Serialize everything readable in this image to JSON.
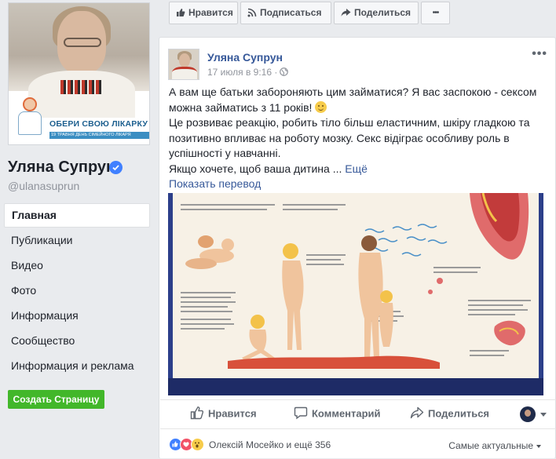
{
  "page": {
    "name": "Уляна Супрун",
    "handle": "@ulanasuprun",
    "cover": {
      "banner_title": "ОБЕРИ СВОЮ ЛІКАРКУ",
      "banner_subtitle": "19 ТРАВНЯ ДЕНЬ СІМЕЙНОГО ЛІКАРЯ"
    }
  },
  "nav": {
    "items": [
      {
        "label": "Главная",
        "active": true
      },
      {
        "label": "Публикации"
      },
      {
        "label": "Видео"
      },
      {
        "label": "Фото"
      },
      {
        "label": "Информация"
      },
      {
        "label": "Сообщество"
      },
      {
        "label": "Информация и реклама"
      }
    ],
    "create_page": "Создать Страницу"
  },
  "actionbar": {
    "like": "Нравится",
    "subscribe": "Подписаться",
    "share": "Поделиться",
    "more": "•••"
  },
  "post": {
    "author": "Уляна Супрун",
    "time": "17 июля в 9:16 ·",
    "more": "•••",
    "text_lines": [
      "А вам ще батьки забороняють цим займатися? Я вас заспокою - сексом можна займатись з 11 років!",
      "Це розвиває реакцію, робить тіло більш еластичним, шкіру гладкою та позитивно впливає на роботу мозку. Секс відіграє особливу роль в успішності у навчанні.",
      "Якщо хочете, щоб ваша дитина ..."
    ],
    "see_more": "Ещё",
    "translate": "Показать перевод",
    "reactions": {
      "like": "Нравится",
      "comment": "Комментарий",
      "share": "Поделиться"
    },
    "summary": {
      "names": "Олексій Мосейко и ещё 356",
      "sort": "Самые актуальные"
    }
  },
  "colors": {
    "link": "#365899",
    "green_button": "#42b72a",
    "background": "#e9ebee",
    "like_blue": "#4080ff",
    "love_red": "#f25268",
    "wow_yellow": "#f7cc4b"
  },
  "icons": {
    "verified": "verified-check-icon",
    "globe": "globe-icon",
    "like": "thumbs-up-icon",
    "rss": "rss-icon",
    "share": "share-arrow-icon",
    "comment": "speech-bubble-icon"
  }
}
